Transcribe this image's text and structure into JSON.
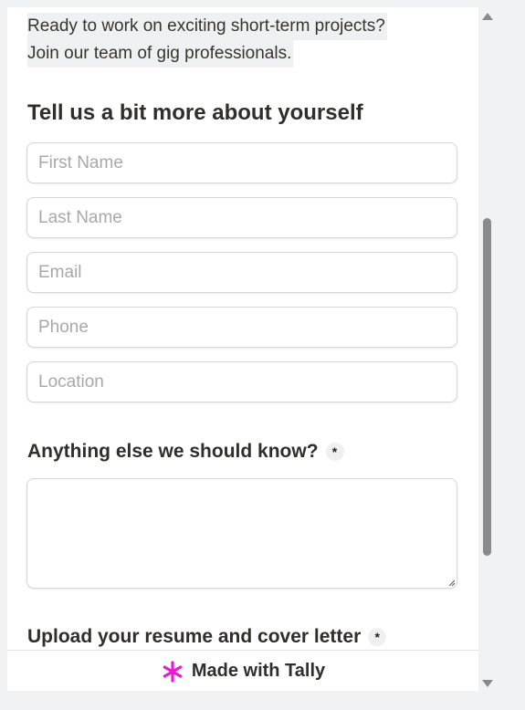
{
  "intro": {
    "line1": "Ready to work on exciting short-term projects?",
    "line2": "Join our team of gig professionals."
  },
  "about_section": {
    "heading": "Tell us a bit more about yourself",
    "fields": {
      "first_name": {
        "placeholder": "First Name",
        "value": ""
      },
      "last_name": {
        "placeholder": "Last Name",
        "value": ""
      },
      "email": {
        "placeholder": "Email",
        "value": ""
      },
      "phone": {
        "placeholder": "Phone",
        "value": ""
      },
      "location": {
        "placeholder": "Location",
        "value": ""
      }
    }
  },
  "anything_else": {
    "label": "Anything else we should know?",
    "required_mark": "*",
    "value": ""
  },
  "upload": {
    "label": "Upload your resume and cover letter",
    "required_mark": "*"
  },
  "footer": {
    "text": "Made with Tally",
    "icon": "asterisk-icon",
    "icon_color": "#e81ad6"
  }
}
